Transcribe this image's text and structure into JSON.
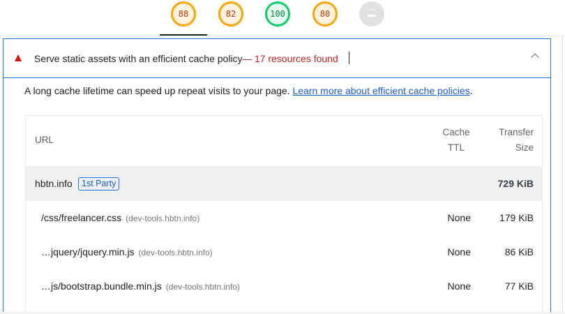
{
  "scores": [
    {
      "value": "88",
      "status": "average"
    },
    {
      "value": "82",
      "status": "average"
    },
    {
      "value": "100",
      "status": "pass"
    },
    {
      "value": "80",
      "status": "average"
    },
    {
      "value": "PWA",
      "status": "na"
    }
  ],
  "audit": {
    "title": "Serve static assets with an efficient cache policy",
    "display_value": "— 17 resources found",
    "description": "A long cache lifetime can speed up repeat visits to your page.",
    "learn_more": "Learn more about efficient cache policies",
    "desc_suffix": "."
  },
  "table": {
    "headers": {
      "url": "URL",
      "ttl_line1": "Cache",
      "ttl_line2": "TTL",
      "size_line1": "Transfer",
      "size_line2": "Size"
    },
    "group": {
      "name": "hbtn.info",
      "badge": "1st Party",
      "size": "729 KiB"
    },
    "rows": [
      {
        "path": "/css/freelancer.css",
        "host": "(dev-tools.hbtn.info)",
        "ttl": "None",
        "size": "179 KiB"
      },
      {
        "path": "…jquery/jquery.min.js",
        "host": "(dev-tools.hbtn.info)",
        "ttl": "None",
        "size": "86 KiB"
      },
      {
        "path": "…js/bootstrap.bundle.min.js",
        "host": "(dev-tools.hbtn.info)",
        "ttl": "None",
        "size": "77 KiB"
      }
    ]
  },
  "colors": {
    "fail": "#eb0f00",
    "average": "#ffa400",
    "pass": "#0cce6b",
    "link": "#1a5ccf",
    "focus_border": "#1a73e8"
  }
}
